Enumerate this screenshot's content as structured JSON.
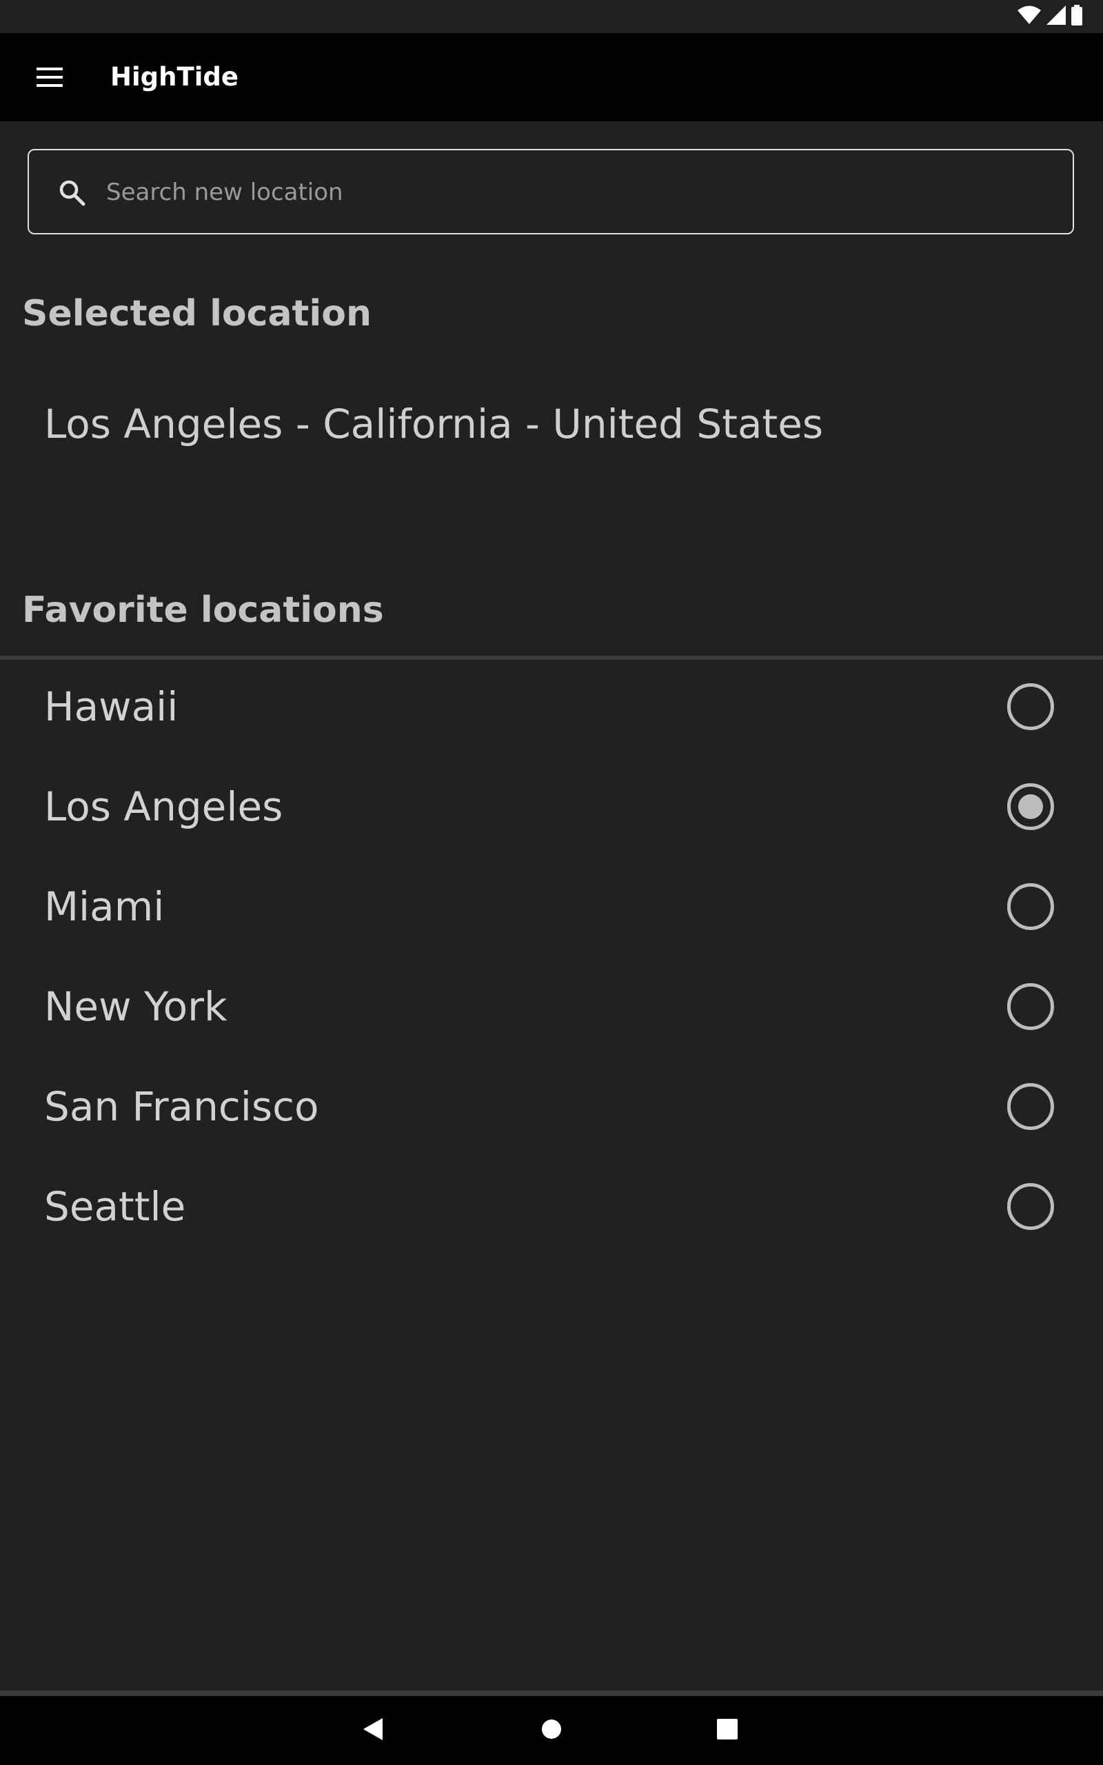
{
  "app": {
    "title": "HighTide",
    "menu_icon": "hamburger-menu-icon"
  },
  "status_bar": {
    "icons": [
      "wifi-icon",
      "cell-signal-icon",
      "battery-icon"
    ]
  },
  "search": {
    "placeholder": "Search new location",
    "value": "",
    "icon": "search-icon"
  },
  "selected_section": {
    "title": "Selected location",
    "value": "Los Angeles - California - United States"
  },
  "favorites_section": {
    "title": "Favorite locations",
    "items": [
      {
        "label": "Hawaii",
        "selected": false
      },
      {
        "label": "Los Angeles",
        "selected": true
      },
      {
        "label": "Miami",
        "selected": false
      },
      {
        "label": "New York",
        "selected": false
      },
      {
        "label": "San Francisco",
        "selected": false
      },
      {
        "label": "Seattle",
        "selected": false
      }
    ]
  },
  "nav_bar": {
    "icons": [
      "back-icon",
      "home-icon",
      "recents-icon"
    ]
  },
  "colors": {
    "background": "#212121",
    "app_bar": "#000000",
    "text_primary": "#d2d2d2",
    "radio": "#bdbdbd"
  }
}
